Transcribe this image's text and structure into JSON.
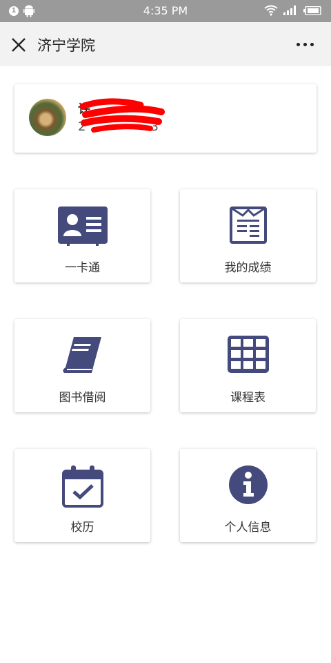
{
  "status_bar": {
    "notification_count": "1",
    "time": "4:35 PM"
  },
  "title_bar": {
    "title": "济宁学院"
  },
  "profile": {
    "name_visible": "许",
    "id_visible_start": "2",
    "id_visible_end": "3"
  },
  "tiles": [
    {
      "label": "一卡通",
      "icon": "id-card-icon"
    },
    {
      "label": "我的成绩",
      "icon": "grades-sheet-icon"
    },
    {
      "label": "图书借阅",
      "icon": "book-icon"
    },
    {
      "label": "课程表",
      "icon": "timetable-grid-icon"
    },
    {
      "label": "校历",
      "icon": "calendar-check-icon"
    },
    {
      "label": "个人信息",
      "icon": "info-icon"
    }
  ],
  "colors": {
    "icon": "#454a7c",
    "status_bar": "#9a9a9a",
    "title_bar": "#f2f2f2",
    "redaction": "#ff0000"
  }
}
